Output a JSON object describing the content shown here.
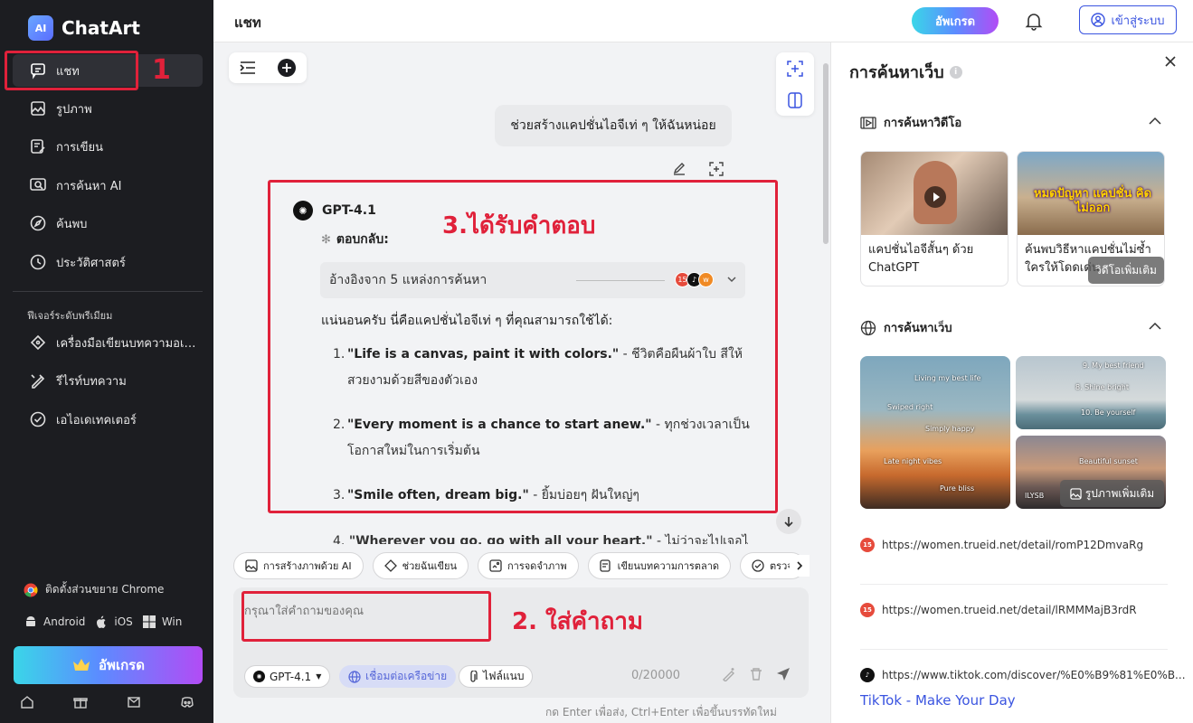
{
  "app": {
    "name": "ChatArt",
    "logo_mark": "AI"
  },
  "sidebar": {
    "items": [
      {
        "label": "แชท",
        "icon": "chat-icon"
      },
      {
        "label": "รูปภาพ",
        "icon": "image-icon"
      },
      {
        "label": "การเขียน",
        "icon": "writing-icon"
      },
      {
        "label": "การค้นหา AI",
        "icon": "ai-search-icon"
      },
      {
        "label": "ค้นพบ",
        "icon": "compass-icon"
      },
      {
        "label": "ประวัติศาสตร์",
        "icon": "history-icon"
      }
    ],
    "premium_title": "ฟีเจอร์ระดับพรีเมียม",
    "premium_items": [
      {
        "label": "เครื่องมือเขียนบทความอเนกประสงค์",
        "icon": "pen-tool-icon"
      },
      {
        "label": "รีไรท์บทความ",
        "icon": "rewrite-icon"
      },
      {
        "label": "เอไอเดเทคเตอร์",
        "icon": "detector-icon"
      }
    ],
    "extension": "ติดตั้งส่วนขยาย Chrome",
    "platforms": [
      "Android",
      "iOS",
      "Win"
    ],
    "upgrade": "อัพเกรด"
  },
  "annotations": {
    "n1": "1",
    "n2": "2. ใส่คำถาม",
    "n3": "3.ได้รับคำตอบ",
    "color": "#e0213a"
  },
  "header": {
    "title": "แชท",
    "upgrade": "อัพเกรด",
    "login": "เข้าสู่ระบบ"
  },
  "chat": {
    "user_message": "ช่วยสร้างแคปชั่นไอจีเท่ ๆ ให้ฉันหน่อย",
    "model": "GPT-4.1",
    "reply_label": "ตอบกลับ:",
    "references": "อ้างอิงจาก 5 แหล่งการค้นหา",
    "intro": "แน่นอนครับ นี่คือแคปชั่นไอจีเท่ ๆ ที่คุณสามารถใช้ได้:",
    "captions": [
      {
        "num": "1.",
        "en": "\"Life is a canvas, paint it with colors.\"",
        "th": " - ชีวิตคือผืนผ้าใบ สีให้สวยงามด้วยสีของตัวเอง"
      },
      {
        "num": "2.",
        "en": "\"Every moment is a chance to start anew.\"",
        "th": " - ทุกช่วงเวลาเป็นโอกาสใหม่ในการเริ่มต้น"
      },
      {
        "num": "3.",
        "en": "\"Smile often, dream big.\"",
        "th": " - ยิ้มบ่อยๆ ฝันใหญ่ๆ"
      },
      {
        "num": "4.",
        "en": "\"Wherever you go, go with all your heart.\"",
        "th": " - ไม่ว่าจะไปเจอไป"
      }
    ]
  },
  "chips": [
    "การสร้างภาพด้วย AI",
    "ช่วยฉันเขียน",
    "การจดจำภาพ",
    "เขียนบทความการตลาด",
    "ตรวจ"
  ],
  "input": {
    "placeholder": "กรุณาใส่คำถามของคุณ",
    "model": "GPT-4.1",
    "web": "เชื่อมต่อเครือข่าย",
    "file": "ไฟล์แนบ",
    "counter": "0/20000",
    "hint": "กด Enter เพื่อส่ง, Ctrl+Enter เพื่อขึ้นบรรทัดใหม่"
  },
  "panel": {
    "title": "การค้นหาเว็บ",
    "video_section": "การค้นหาวิดีโอ",
    "videos": [
      {
        "caption": "แคปชั่นไอจีสั้นๆ ด้วย ChatGPT"
      },
      {
        "caption": "ค้นพบวิธีหาแคปชั่นไม่ซ้ำใครให้โดดเด่น"
      }
    ],
    "video_thumb_text": "หมดปัญหา แคปชั่น คิดไม่ออก",
    "more_videos": "วิดีโอเพิ่มเติม",
    "web_section": "การค้นหาเว็บ",
    "image_text_1": [
      "Living my best life",
      "Swiped right",
      "Simply happy",
      "Late night vibes",
      "Pure bliss"
    ],
    "image_text_2": [
      "9. My best friend",
      "8. Shine bright",
      "10. Be yourself"
    ],
    "image_text_3": [
      "Beautiful sunset",
      "ILYSB"
    ],
    "more_images": "รูปภาพเพิ่มเติม",
    "links": [
      {
        "url": "https://women.trueid.net/detail/romP12DmvaRg",
        "icon": "trueid-icon"
      },
      {
        "url": "https://women.trueid.net/detail/lRMMMajB3rdR",
        "icon": "trueid-icon"
      },
      {
        "url": "https://www.tiktok.com/discover/%E0%B9%81%E0%B...",
        "icon": "tiktok-icon"
      }
    ],
    "tiktok_title": "TikTok - Make Your Day"
  }
}
